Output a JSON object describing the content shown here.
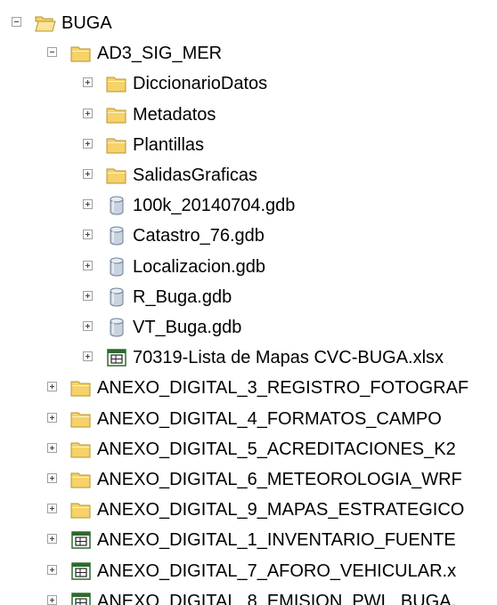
{
  "tree": {
    "root": {
      "label": "BUGA",
      "icon": "folder-open-icon",
      "expanded": true
    },
    "project": {
      "label": "AD3_SIG_MER",
      "icon": "folder-icon",
      "expanded": true
    },
    "project_children": [
      {
        "label": "DiccionarioDatos",
        "icon": "folder-icon"
      },
      {
        "label": "Metadatos",
        "icon": "folder-icon"
      },
      {
        "label": "Plantillas",
        "icon": "folder-icon"
      },
      {
        "label": "SalidasGraficas",
        "icon": "folder-icon"
      },
      {
        "label": "100k_20140704.gdb",
        "icon": "geodatabase-icon"
      },
      {
        "label": "Catastro_76.gdb",
        "icon": "geodatabase-icon"
      },
      {
        "label": "Localizacion.gdb",
        "icon": "geodatabase-icon"
      },
      {
        "label": "R_Buga.gdb",
        "icon": "geodatabase-icon"
      },
      {
        "label": "VT_Buga.gdb",
        "icon": "geodatabase-icon"
      },
      {
        "label": "70319-Lista de Mapas CVC-BUGA.xlsx",
        "icon": "spreadsheet-icon"
      }
    ],
    "root_children": [
      {
        "label": "ANEXO_DIGITAL_3_REGISTRO_FOTOGRAF",
        "icon": "folder-icon"
      },
      {
        "label": "ANEXO_DIGITAL_4_FORMATOS_CAMPO",
        "icon": "folder-icon"
      },
      {
        "label": "ANEXO_DIGITAL_5_ACREDITACIONES_K2",
        "icon": "folder-icon"
      },
      {
        "label": "ANEXO_DIGITAL_6_METEOROLOGIA_WRF",
        "icon": "folder-icon"
      },
      {
        "label": "ANEXO_DIGITAL_9_MAPAS_ESTRATEGICO",
        "icon": "folder-icon"
      },
      {
        "label": "ANEXO_DIGITAL_1_INVENTARIO_FUENTE",
        "icon": "spreadsheet-icon"
      },
      {
        "label": "ANEXO_DIGITAL_7_AFORO_VEHICULAR.x",
        "icon": "spreadsheet-icon"
      },
      {
        "label": "ANEXO_DIGITAL_8_EMISION_PWL_BUGA.",
        "icon": "spreadsheet-icon"
      }
    ],
    "colors": {
      "folder_fill": "#f5d26a",
      "folder_stroke": "#b8932a",
      "db_fill": "#c9d3df",
      "db_stroke": "#6e7f93",
      "sheet_fill": "#ffffff",
      "sheet_stroke": "#2d6a2d"
    }
  }
}
